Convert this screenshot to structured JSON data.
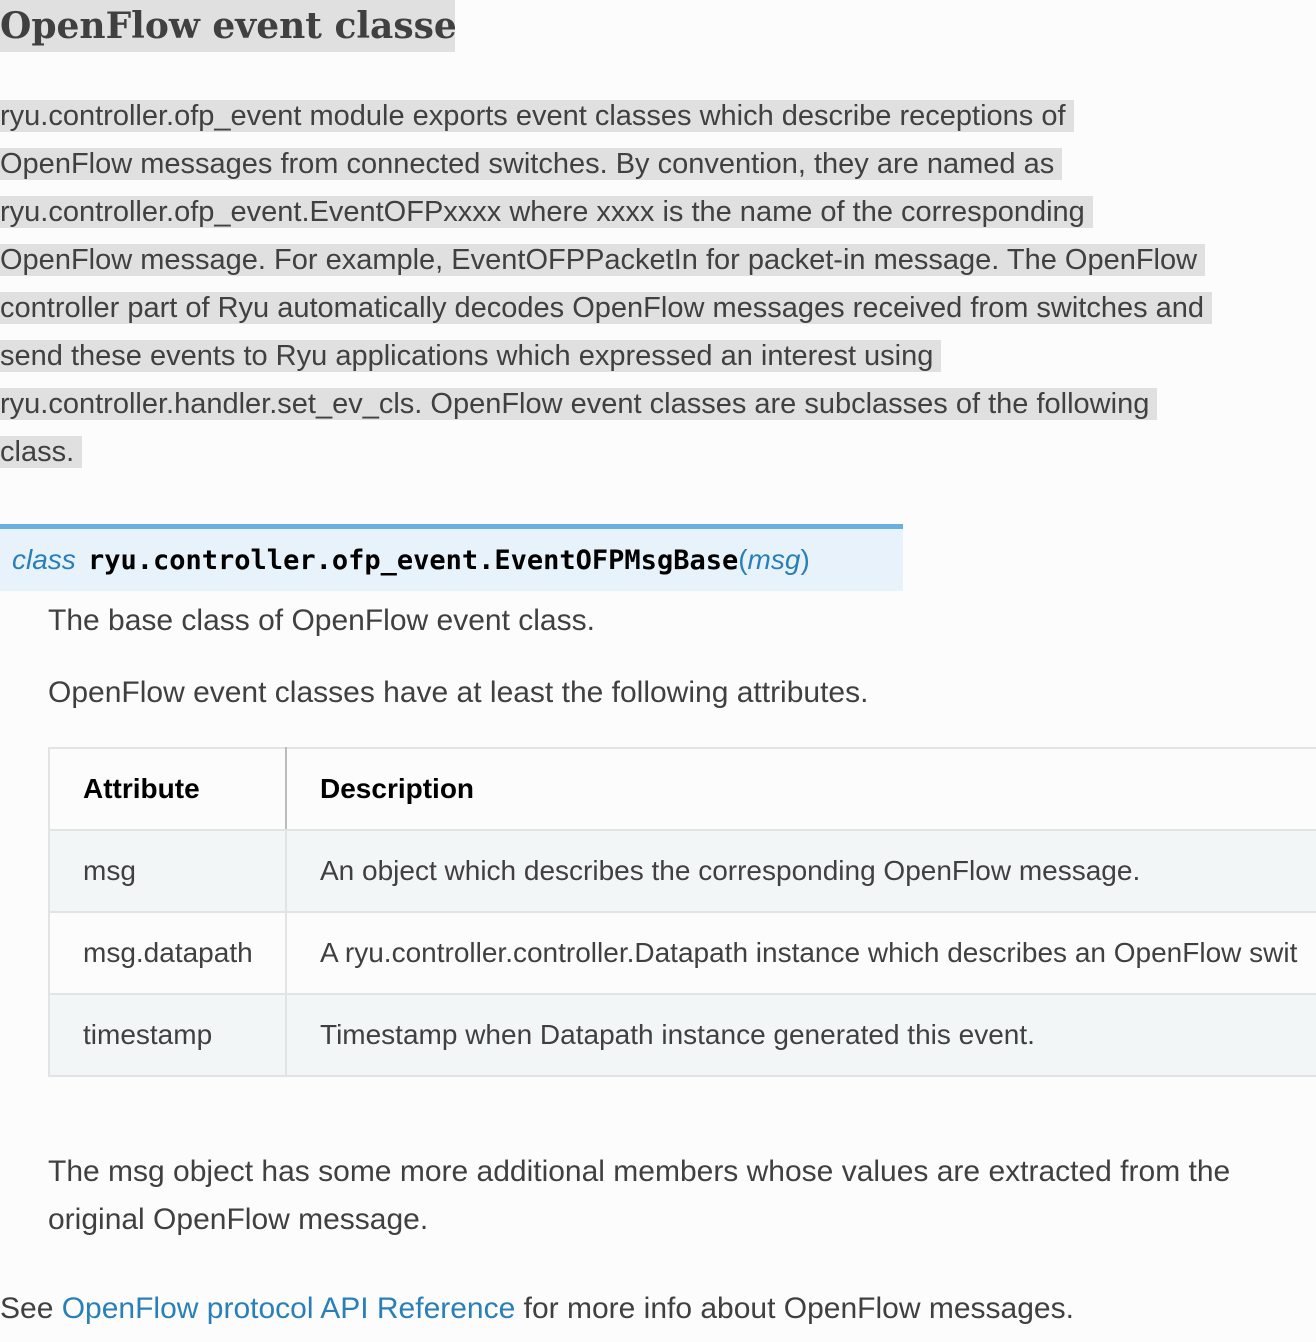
{
  "heading": "OpenFlow event classes",
  "intro_lines": [
    "ryu.controller.ofp_event module exports event classes which describe receptions of",
    "OpenFlow messages from connected switches. By convention, they are named as",
    "ryu.controller.ofp_event.EventOFPxxxx where xxxx is the name of the corresponding",
    "OpenFlow message. For example, EventOFPPacketIn for packet-in message. The OpenFlow",
    "controller part of Ryu automatically decodes OpenFlow messages received from switches and",
    "send these events to Ryu applications which expressed an interest using",
    "ryu.controller.handler.set_ev_cls. OpenFlow event classes are subclasses of the following",
    "class."
  ],
  "signature": {
    "keyword": "class",
    "name": "ryu.controller.ofp_event.EventOFPMsgBase",
    "open_paren": "(",
    "param": "msg",
    "close_paren": ")"
  },
  "description_1": "The base class of OpenFlow event class.",
  "description_2": "OpenFlow event classes have at least the following attributes.",
  "table": {
    "headers": [
      "Attribute",
      "Description"
    ],
    "rows": [
      [
        "msg",
        "An object which describes the corresponding OpenFlow message."
      ],
      [
        "msg.datapath",
        "A ryu.controller.controller.Datapath instance which describes an OpenFlow swit"
      ],
      [
        "timestamp",
        "Timestamp when Datapath instance generated this event."
      ]
    ]
  },
  "extra_text": "The msg object has some more additional members whose values are extracted from the original OpenFlow message.",
  "see_also": {
    "prefix": "See ",
    "link_text": "OpenFlow protocol API Reference",
    "suffix": " for more info about OpenFlow messages."
  },
  "colors": {
    "link": "#2980b9",
    "signature_bg": "#e7f2fa",
    "signature_border": "#6ab0de",
    "highlight": "#e0e0e0"
  }
}
